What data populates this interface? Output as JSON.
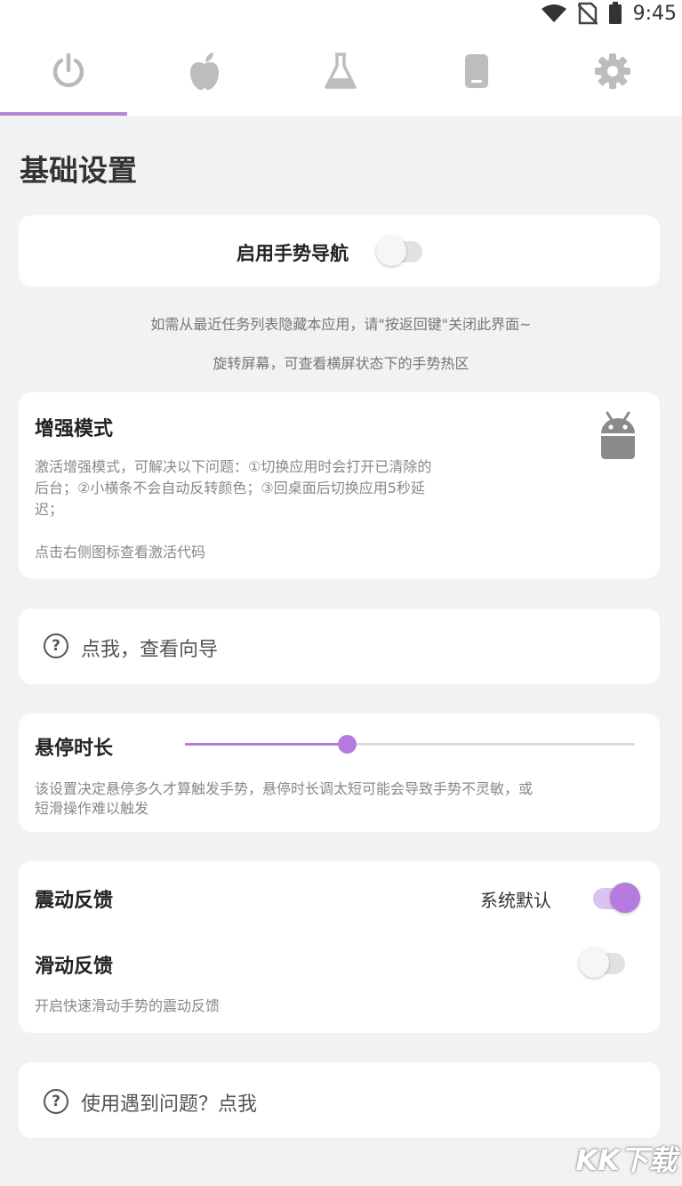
{
  "status": {
    "time": "9:45"
  },
  "tabs": [
    {
      "icon": "power-icon",
      "active": true
    },
    {
      "icon": "apple-icon"
    },
    {
      "icon": "flask-icon"
    },
    {
      "icon": "phone-icon"
    },
    {
      "icon": "gear-icon"
    }
  ],
  "page_title": "基础设置",
  "gesture_nav": {
    "label": "启用手势导航",
    "enabled": false
  },
  "hints": {
    "line1": "如需从最近任务列表隐藏本应用，请\"按返回键\"关闭此界面~",
    "line2": "旋转屏幕，可查看横屏状态下的手势热区"
  },
  "enhanced_mode": {
    "title": "增强模式",
    "desc_line1": "激活增强模式，可解决以下问题：①切换应用时会打开已清除的",
    "desc_line2": "后台；②小横条不会自动反转颜色；③回桌面后切换应用5秒延",
    "desc_line3": "迟；",
    "tip": "点击右侧图标查看激活代码",
    "icon": "android-icon"
  },
  "guide": {
    "label": "点我，查看向导"
  },
  "hover_duration": {
    "title": "悬停时长",
    "value_fraction": 0.36,
    "desc_line1": "该设置决定悬停多久才算触发手势，悬停时长调太短可能会导致手势不灵敏，或",
    "desc_line2": "短滑操作难以触发"
  },
  "vibration": {
    "title": "震动反馈",
    "value": "系统默认",
    "enabled": true,
    "slide_title": "滑动反馈",
    "slide_enabled": false,
    "slide_desc": "开启快速滑动手势的震动反馈"
  },
  "problem": {
    "label": "使用遇到问题？点我"
  },
  "watermark": "KK下载",
  "colors": {
    "accent": "#b57bde",
    "background": "#f2f2f2"
  }
}
